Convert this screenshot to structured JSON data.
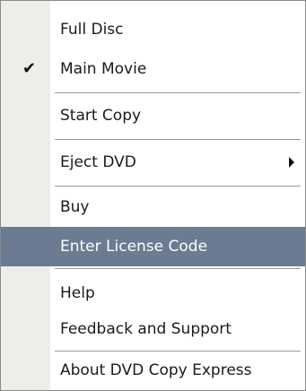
{
  "menu": {
    "items": [
      {
        "label": "Full Disc"
      },
      {
        "label": "Main Movie",
        "checked": true,
        "check_glyph": "✔"
      },
      {
        "label": "Start Copy"
      },
      {
        "label": "Eject DVD",
        "has_submenu": true
      },
      {
        "label": "Buy"
      },
      {
        "label": "Enter License Code",
        "highlighted": true
      },
      {
        "label": "Help"
      },
      {
        "label": "Feedback and Support"
      },
      {
        "label": "About DVD Copy Express"
      }
    ]
  },
  "colors": {
    "highlight_background": "#6b7b91",
    "highlight_text": "#ffffff",
    "gutter_background": "#eeede8",
    "separator": "#9a9a9a"
  }
}
